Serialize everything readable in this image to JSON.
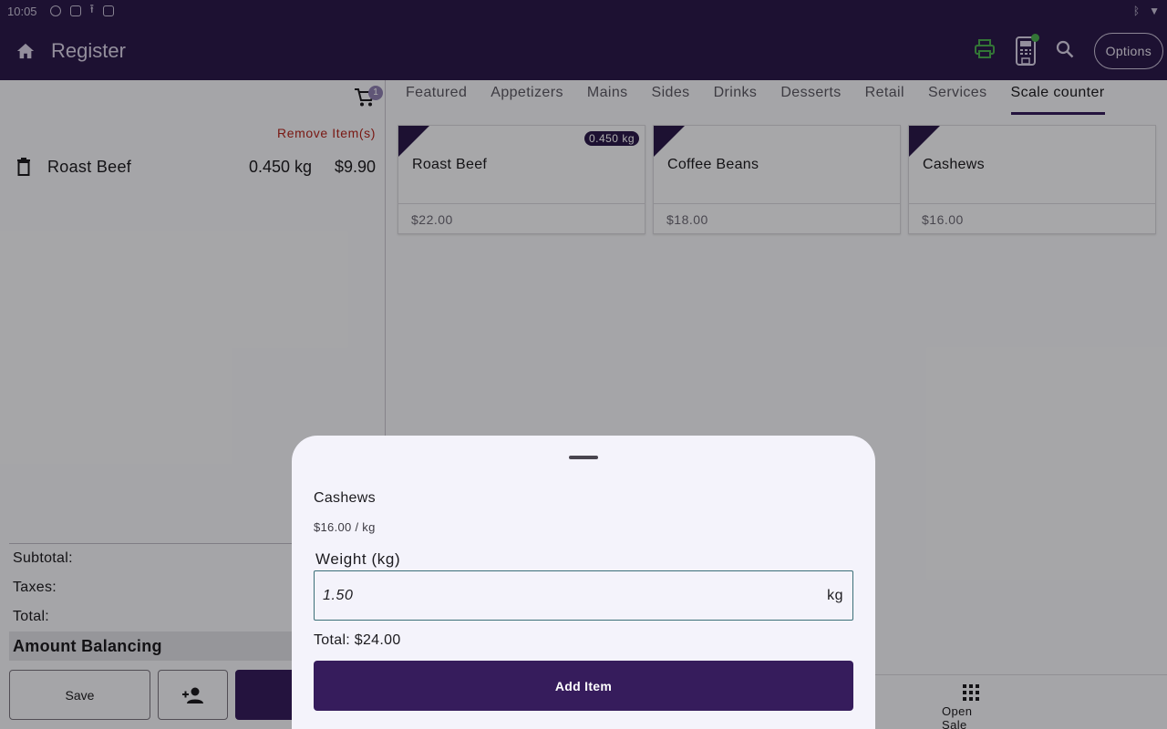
{
  "status_bar": {
    "time": "10:05"
  },
  "app_bar": {
    "title": "Register",
    "options_label": "Options"
  },
  "cart": {
    "item_count": "1",
    "remove_label": "Remove Item(s)",
    "items": [
      {
        "name": "Roast Beef",
        "qty": "0.450 kg",
        "price": "$9.90"
      }
    ],
    "subtotal_label": "Subtotal:",
    "taxes_label": "Taxes:",
    "total_label": "Total:",
    "balance_label": "Amount Balancing",
    "save_label": "Save"
  },
  "tabs": [
    "Featured",
    "Appetizers",
    "Mains",
    "Sides",
    "Drinks",
    "Desserts",
    "Retail",
    "Services",
    "Scale counter"
  ],
  "active_tab": "Scale counter",
  "products": [
    {
      "name": "Roast Beef",
      "price": "$22.00",
      "weight_badge": "0.450 kg"
    },
    {
      "name": "Coffee Beans",
      "price": "$18.00"
    },
    {
      "name": "Cashews",
      "price": "$16.00"
    }
  ],
  "bottom_nav": {
    "open_sale_label": "Open Sale"
  },
  "sheet": {
    "title": "Cashews",
    "unit_price": "$16.00 / kg",
    "weight_label": "Weight (kg)",
    "weight_value": "1.50",
    "weight_suffix": "kg",
    "total": "Total: $24.00",
    "add_label": "Add Item"
  },
  "colors": {
    "brand": "#2b1a4a",
    "primary_button": "#361c5c",
    "danger": "#b3261e",
    "status_ok": "#4caf50"
  }
}
